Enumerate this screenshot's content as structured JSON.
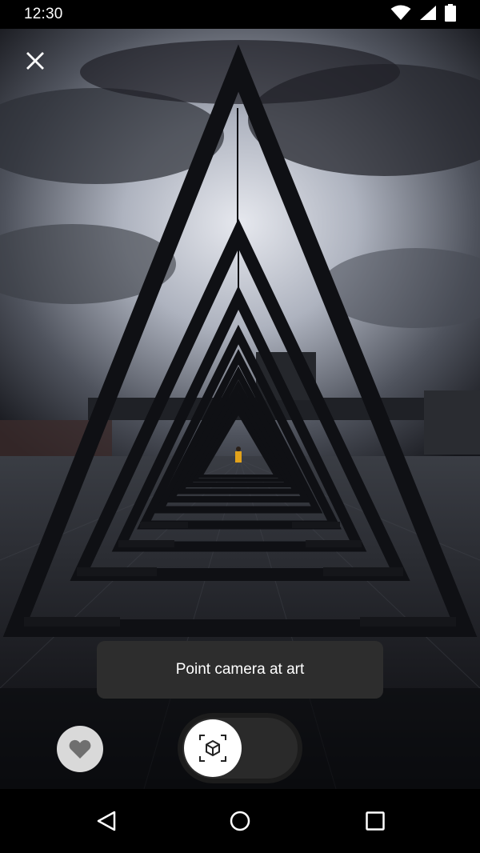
{
  "status_bar": {
    "time": "12:30",
    "icons": [
      "wifi-icon",
      "cellular-signal-icon",
      "battery-icon"
    ]
  },
  "camera": {
    "subject": "triangle-frames-tunnel-photo"
  },
  "header": {
    "close_icon": "close-icon"
  },
  "hint": {
    "text": "Point camera at art"
  },
  "controls": {
    "favorite_icon": "heart-icon",
    "mode_toggle_icon": "ar-cube-icon",
    "toggle_on": false
  },
  "nav_bar": {
    "buttons": [
      "back-icon",
      "home-icon",
      "recents-icon"
    ]
  },
  "colors": {
    "toast_bg": "#2d2d2d",
    "favorite_bg": "#d9d9d9",
    "toggle_bg": "#2a2a2a",
    "knob": "#ffffff"
  }
}
